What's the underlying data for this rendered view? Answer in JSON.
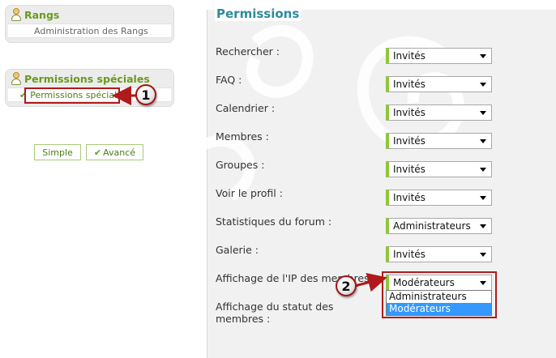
{
  "sidebar": {
    "rangs": {
      "title": "Rangs",
      "link": "Administration des Rangs"
    },
    "permissions_speciales": {
      "title": "Permissions spéciales",
      "link": "Permissions spéciales"
    },
    "mode_buttons": {
      "simple": "Simple",
      "avance": "Avancé"
    }
  },
  "main": {
    "title": "Permissions",
    "fields": [
      {
        "label": "Rechercher :",
        "value": "Invités"
      },
      {
        "label": "FAQ :",
        "value": "Invités"
      },
      {
        "label": "Calendrier :",
        "value": "Invités"
      },
      {
        "label": "Membres :",
        "value": "Invités"
      },
      {
        "label": "Groupes :",
        "value": "Invités"
      },
      {
        "label": "Voir le profil :",
        "value": "Invités"
      },
      {
        "label": "Statistiques du forum :",
        "value": "Administrateurs"
      },
      {
        "label": "Galerie :",
        "value": "Invités"
      },
      {
        "label": "Affichage de l'IP des membres :",
        "value": "Modérateurs"
      },
      {
        "label": "Affichage du statut des membres :"
      }
    ],
    "open_dropdown": {
      "options": [
        "Administrateurs",
        "Modérateurs"
      ],
      "highlighted": "Modérateurs"
    }
  },
  "annotations": {
    "badge1": "1",
    "badge2": "2",
    "color": "#b01a1a"
  },
  "colors": {
    "accent_green": "#8fc73a",
    "title_teal": "#2e8a9c",
    "sidebar_green": "#6a9a1e"
  }
}
